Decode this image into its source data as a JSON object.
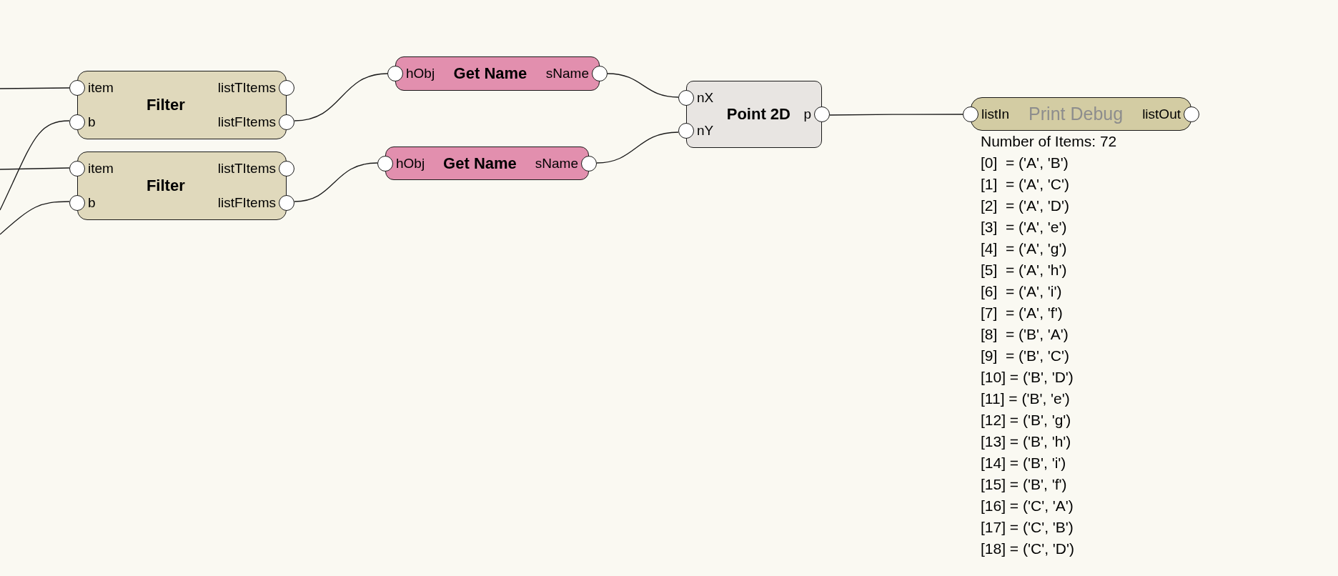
{
  "canvas": {
    "nodes": [
      {
        "kind": "filter",
        "title": "Filter",
        "inputs": [
          "item",
          "b"
        ],
        "outputs": [
          "listTItems",
          "listFItems"
        ]
      },
      {
        "kind": "filter",
        "title": "Filter",
        "inputs": [
          "item",
          "b"
        ],
        "outputs": [
          "listTItems",
          "listFItems"
        ]
      },
      {
        "kind": "get_name",
        "title": "Get Name",
        "inputs": [
          "hObj"
        ],
        "outputs": [
          "sName"
        ]
      },
      {
        "kind": "get_name",
        "title": "Get Name",
        "inputs": [
          "hObj"
        ],
        "outputs": [
          "sName"
        ]
      },
      {
        "kind": "point",
        "title": "Point 2D",
        "inputs": [
          "nX",
          "nY"
        ],
        "outputs": [
          "p"
        ]
      },
      {
        "kind": "print_debug",
        "title": "Print Debug",
        "inputs": [
          "listIn"
        ],
        "outputs": [
          "listOut"
        ],
        "output": {
          "summary": "Number of Items: 72",
          "lines": [
            "[0]  = ('A', 'B')",
            "[1]  = ('A', 'C')",
            "[2]  = ('A', 'D')",
            "[3]  = ('A', 'e')",
            "[4]  = ('A', 'g')",
            "[5]  = ('A', 'h')",
            "[6]  = ('A', 'i')",
            "[7]  = ('A', 'f')",
            "[8]  = ('B', 'A')",
            "[9]  = ('B', 'C')",
            "[10] = ('B', 'D')",
            "[11] = ('B', 'e')",
            "[12] = ('B', 'g')",
            "[13] = ('B', 'h')",
            "[14] = ('B', 'i')",
            "[15] = ('B', 'f')",
            "[16] = ('C', 'A')",
            "[17] = ('C', 'B')",
            "[18] = ('C', 'D')"
          ]
        }
      }
    ]
  }
}
